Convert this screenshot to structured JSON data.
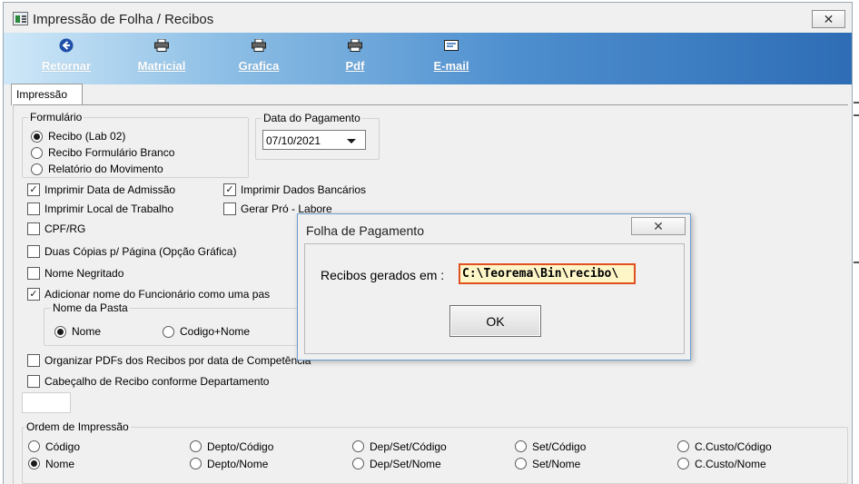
{
  "window": {
    "title": "Impressão de Folha / Recibos",
    "close_glyph": "✕"
  },
  "toolbar": {
    "buttons": [
      {
        "label": "Retornar",
        "icon": "arrow-left-circle-icon"
      },
      {
        "label": "Matricial",
        "icon": "printer-icon"
      },
      {
        "label": "Grafica",
        "icon": "printer-icon"
      },
      {
        "label": "Pdf",
        "icon": "printer-icon"
      },
      {
        "label": "E-mail",
        "icon": "email-icon"
      }
    ]
  },
  "tabs": [
    {
      "label": "Impressão"
    }
  ],
  "formulario": {
    "label": "Formulário",
    "options": [
      "Recibo (Lab 02)",
      "Recibo Formulário Branco",
      "Relatório do Movimento"
    ],
    "selected": "Recibo (Lab 02)"
  },
  "data_pagamento": {
    "label": "Data do Pagamento",
    "value": "07/10/2021"
  },
  "checkboxes": {
    "imprimir_data_admissao": {
      "label": "Imprimir Data de Admissão",
      "checked": true
    },
    "imprimir_dados_bancarios": {
      "label": "Imprimir Dados Bancários",
      "checked": true
    },
    "imprimir_local_trabalho": {
      "label": "Imprimir Local de Trabalho",
      "checked": false
    },
    "gerar_pro_labore": {
      "label": "Gerar Pró - Labore",
      "checked": false
    },
    "cpf_rg": {
      "label": "CPF/RG",
      "checked": false
    },
    "duas_copias": {
      "label": "Duas Cópias p/ Página (Opção Gráfica)",
      "checked": false
    },
    "nome_negritado": {
      "label": "Nome Negritado",
      "checked": false
    },
    "adicionar_nome": {
      "label": "Adicionar nome do Funcionário como uma pas",
      "checked": true
    },
    "organizar_pdfs": {
      "label": "Organizar PDFs dos Recibos por data de Competência",
      "checked": false
    },
    "cabecalho_recibo": {
      "label": "Cabeçalho de Recibo conforme Departamento",
      "checked": false
    }
  },
  "nome_pasta": {
    "label": "Nome da Pasta",
    "options": [
      "Nome",
      "Codigo+Nome"
    ],
    "selected": "Nome"
  },
  "ordem_impressao": {
    "label": "Ordem de Impressão",
    "row1": [
      "Código",
      "Depto/Código",
      "Dep/Set/Código",
      "Set/Código",
      "C.Custo/Código"
    ],
    "row2": [
      "Nome",
      "Depto/Nome",
      "Dep/Set/Nome",
      "Set/Nome",
      "C.Custo/Nome"
    ],
    "selected": "Nome"
  },
  "dialog": {
    "title": "Folha de Pagamento",
    "close_glyph": "✕",
    "message_label": "Recibos gerados em :",
    "path": "C:\\Teorema\\Bin\\recibo\\",
    "ok_label": "OK"
  },
  "colors": {
    "toolbar_start": "#cfe8f8",
    "toolbar_end": "#2e6db5",
    "path_border": "#e05020",
    "path_fill": "#fff6c8"
  }
}
